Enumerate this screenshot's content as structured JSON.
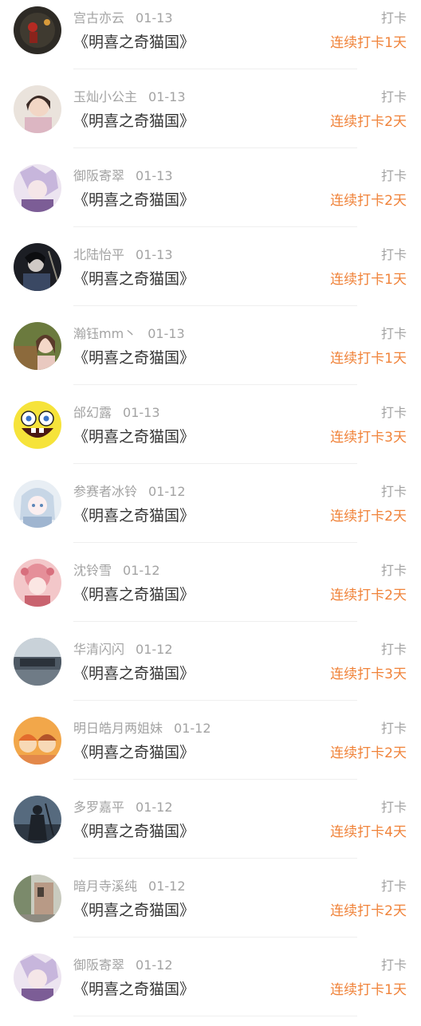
{
  "colors": {
    "name_gray": "#a3a3a3",
    "title_dark": "#333333",
    "streak_orange": "#f0833a",
    "divider": "#efefef"
  },
  "checkins": [
    {
      "user": "宫古亦云",
      "date": "01-13",
      "book": "《明喜之奇猫国》",
      "type": "打卡",
      "streak": "连续打卡1天",
      "avatar": "avatar-dark-red-figure"
    },
    {
      "user": "玉灿小公主",
      "date": "01-13",
      "book": "《明喜之奇猫国》",
      "type": "打卡",
      "streak": "连续打卡2天",
      "avatar": "avatar-girl-face"
    },
    {
      "user": "御阪寄翠",
      "date": "01-13",
      "book": "《明喜之奇猫国》",
      "type": "打卡",
      "streak": "连续打卡2天",
      "avatar": "avatar-anime-purple"
    },
    {
      "user": "北陆怡平",
      "date": "01-13",
      "book": "《明喜之奇猫国》",
      "type": "打卡",
      "streak": "连续打卡1天",
      "avatar": "avatar-dark-anime"
    },
    {
      "user": "瀚钰mm丶",
      "date": "01-13",
      "book": "《明喜之奇猫国》",
      "type": "打卡",
      "streak": "连续打卡1天",
      "avatar": "avatar-girl-green"
    },
    {
      "user": "邰幻露",
      "date": "01-13",
      "book": "《明喜之奇猫国》",
      "type": "打卡",
      "streak": "连续打卡3天",
      "avatar": "avatar-spongebob"
    },
    {
      "user": "参赛者冰铃",
      "date": "01-12",
      "book": "《明喜之奇猫国》",
      "type": "打卡",
      "streak": "连续打卡2天",
      "avatar": "avatar-anime-blue"
    },
    {
      "user": "沈铃雪",
      "date": "01-12",
      "book": "《明喜之奇猫国》",
      "type": "打卡",
      "streak": "连续打卡2天",
      "avatar": "avatar-anime-pink"
    },
    {
      "user": "华清闪闪",
      "date": "01-12",
      "book": "《明喜之奇猫国》",
      "type": "打卡",
      "streak": "连续打卡3天",
      "avatar": "avatar-landscape-gray"
    },
    {
      "user": "明日皓月两姐妹",
      "date": "01-12",
      "book": "《明喜之奇猫国》",
      "type": "打卡",
      "streak": "连续打卡2天",
      "avatar": "avatar-cartoon-orange"
    },
    {
      "user": "多罗嘉平",
      "date": "01-12",
      "book": "《明喜之奇猫国》",
      "type": "打卡",
      "streak": "连续打卡4天",
      "avatar": "avatar-warrior-dark"
    },
    {
      "user": "暗月寺溪纯",
      "date": "01-12",
      "book": "《明喜之奇猫国》",
      "type": "打卡",
      "streak": "连续打卡2天",
      "avatar": "avatar-street-scene"
    },
    {
      "user": "御阪寄翠",
      "date": "01-12",
      "book": "《明喜之奇猫国》",
      "type": "打卡",
      "streak": "连续打卡1天",
      "avatar": "avatar-anime-purple"
    }
  ]
}
